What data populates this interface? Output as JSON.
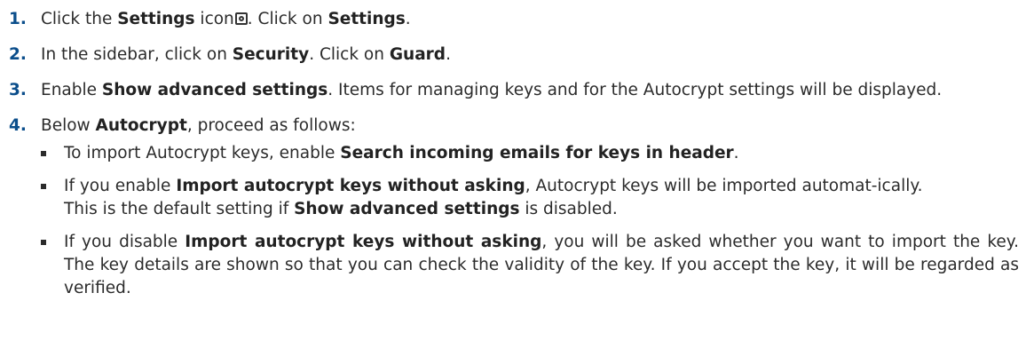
{
  "steps": [
    {
      "num": "1.",
      "p1": "Click the ",
      "b1": "Settings",
      "p2": " icon",
      "icon": "gear-icon",
      "p3": ". Click on ",
      "b2": "Settings",
      "p4": "."
    },
    {
      "num": "2.",
      "p1": "In the sidebar, click on ",
      "b1": "Security",
      "p2": ". Click on ",
      "b2": "Guard",
      "p3": "."
    },
    {
      "num": "3.",
      "p1": "Enable ",
      "b1": "Show advanced settings",
      "p2": ". Items for managing keys and for the Autocrypt settings will be displayed."
    },
    {
      "num": "4.",
      "p1": "Below ",
      "b1": "Autocrypt",
      "p2": ", proceed as follows:",
      "bullets": [
        {
          "p1": "To import Autocrypt keys, enable ",
          "b1": "Search incoming emails for keys in header",
          "p2": "."
        },
        {
          "p1": "If you enable ",
          "b1": "Import autocrypt keys without asking",
          "p2": ", Autocrypt keys will be imported automat-ically.",
          "p3": "This is the default setting if ",
          "b2": "Show advanced settings",
          "p4": " is disabled."
        },
        {
          "p1": "If you disable ",
          "b1": "Import autocrypt keys without asking",
          "p2": ", you will be asked whether you want to import the key. The key details are shown so that you can check the validity of the key. If you accept the key, it will be regarded as verified."
        }
      ]
    }
  ]
}
